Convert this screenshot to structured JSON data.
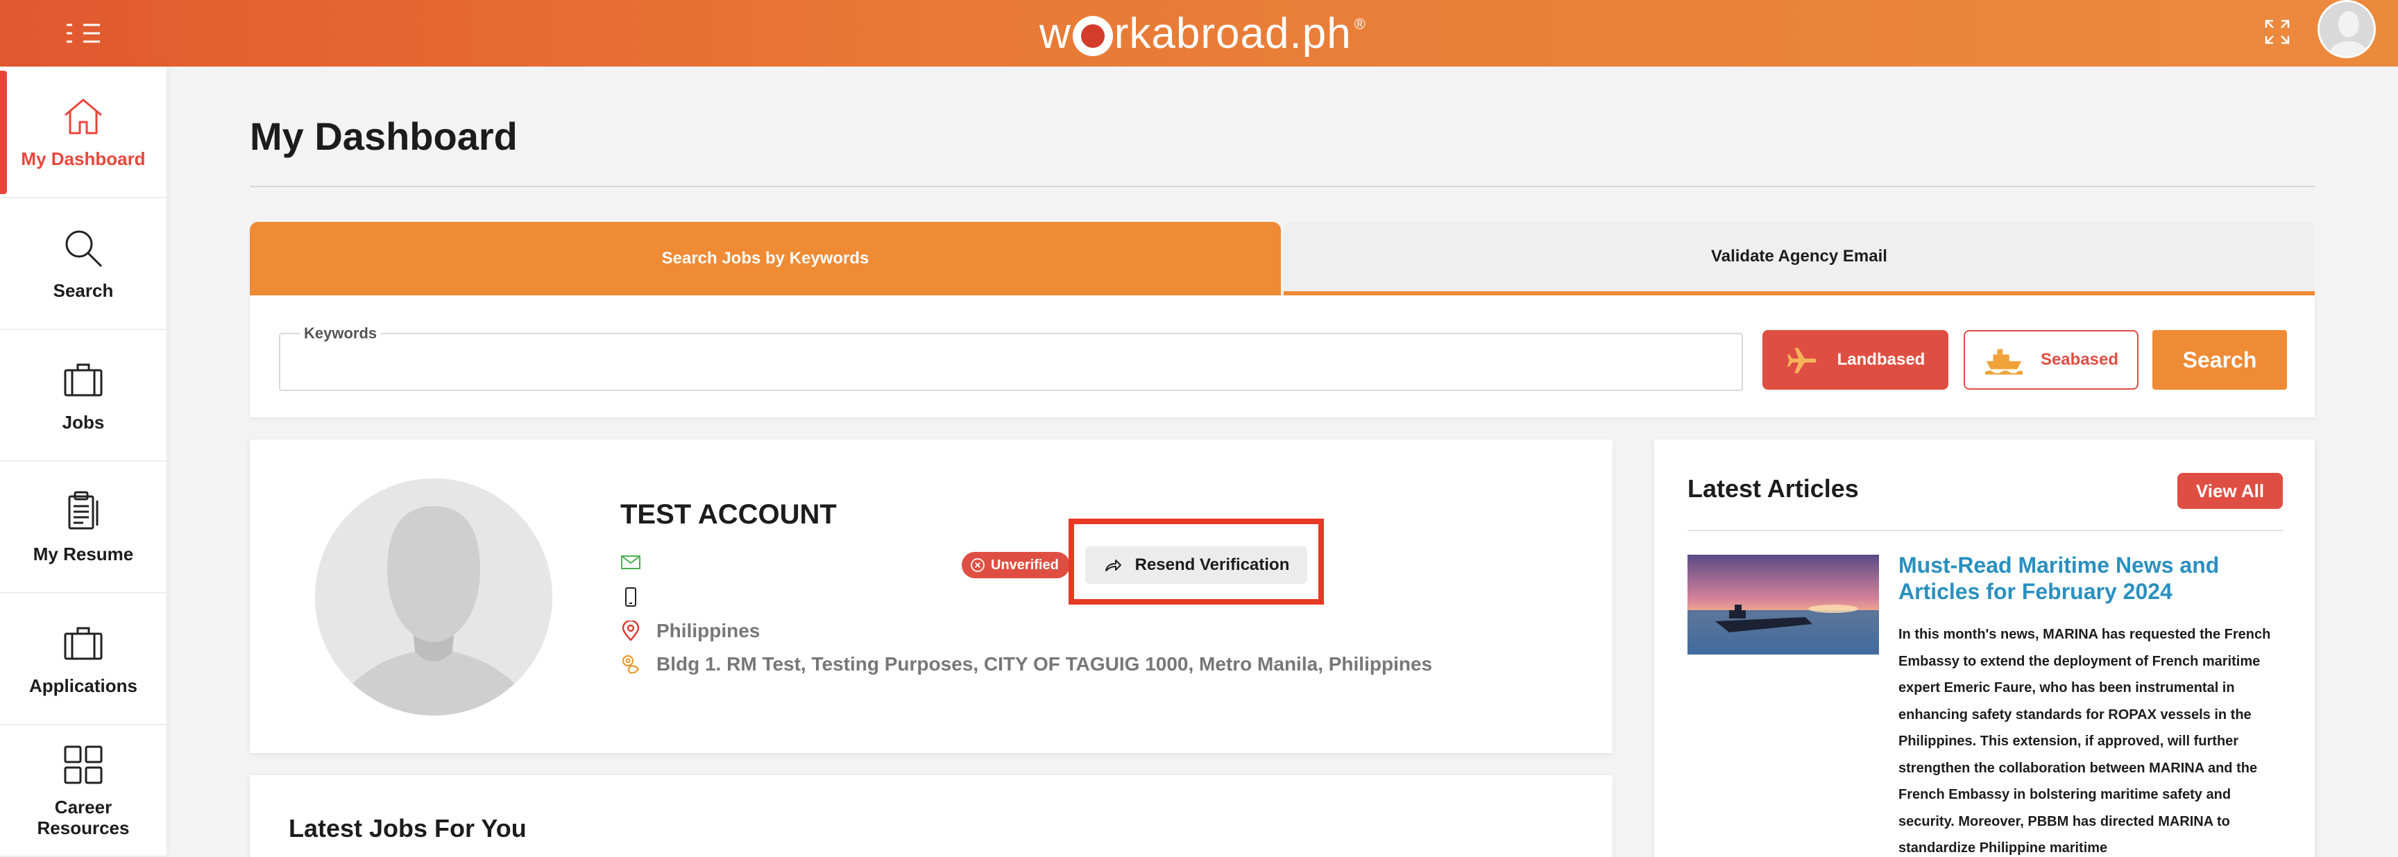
{
  "header": {
    "logo_text_left": "w",
    "logo_text_right": "rkabroad.ph",
    "logo_mark": "®"
  },
  "sidebar": {
    "items": [
      {
        "label": "My Dashboard",
        "icon": "home-icon",
        "active": true
      },
      {
        "label": "Search",
        "icon": "search-icon",
        "active": false
      },
      {
        "label": "Jobs",
        "icon": "briefcase-icon",
        "active": false
      },
      {
        "label": "My Resume",
        "icon": "resume-icon",
        "active": false
      },
      {
        "label": "Applications",
        "icon": "applications-icon",
        "active": false
      },
      {
        "label": "Career Resources",
        "icon": "grid-icon",
        "active": false
      }
    ]
  },
  "main": {
    "title": "My Dashboard",
    "tabs": [
      {
        "label": "Search Jobs by Keywords",
        "active": true
      },
      {
        "label": "Validate Agency Email",
        "active": false
      }
    ],
    "search": {
      "keywords_label": "Keywords",
      "keywords_value": "",
      "landbased_label": "Landbased",
      "seabased_label": "Seabased",
      "search_label": "Search"
    },
    "profile": {
      "name": "TEST ACCOUNT",
      "email": "",
      "phone": "",
      "country": "Philippines",
      "address": "Bldg 1. RM Test, Testing Purposes, CITY OF TAGUIG 1000, Metro Manila, Philippines",
      "status_badge": "Unverified",
      "resend_label": "Resend Verification"
    },
    "latest_jobs_title": "Latest Jobs For You"
  },
  "articles": {
    "title": "Latest Articles",
    "view_all_label": "View All",
    "items": [
      {
        "title": "Must-Read Maritime News and Articles for February 2024",
        "excerpt": "In this month's news, MARINA has requested the French Embassy to extend the deployment of French maritime expert Emeric Faure, who has been instrumental in enhancing safety standards for ROPAX vessels in the Philippines. This extension, if approved, will further strengthen the collaboration between MARINA and the French Embassy in bolstering maritime safety and security. Moreover, PBBM has directed MARINA to standardize Philippine maritime"
      }
    ]
  },
  "colors": {
    "accent_orange": "#ef8a35",
    "accent_red": "#df4e42",
    "link_blue": "#2a8fc0",
    "highlight_red": "#e63a24"
  }
}
